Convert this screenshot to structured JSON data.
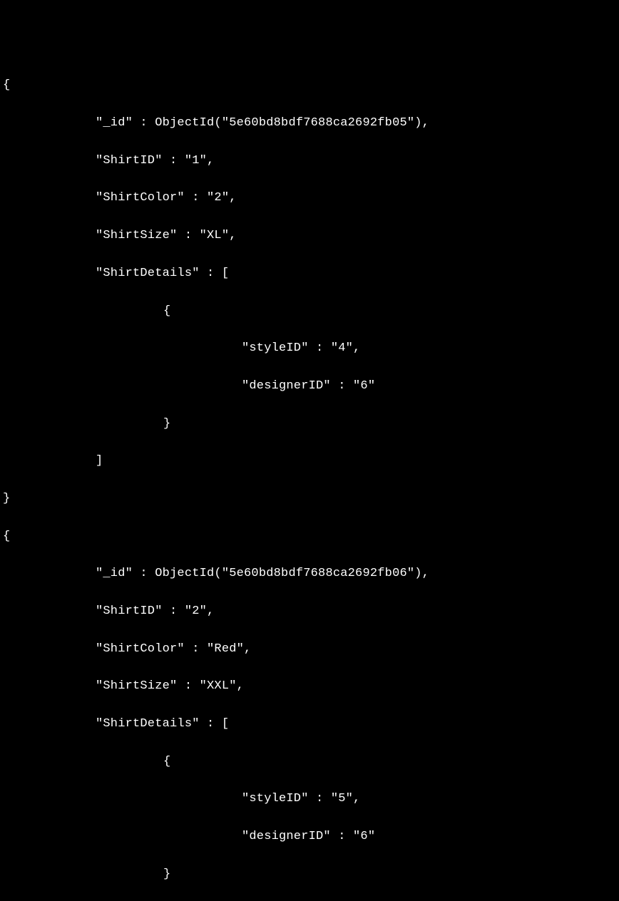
{
  "documents": [
    {
      "open_brace": "{",
      "id_line": "\"_id\" : ObjectId(\"5e60bd8bdf7688ca2692fb05\"),",
      "shirt_id_line": "\"ShirtID\" : \"1\",",
      "shirt_color_line": "\"ShirtColor\" : \"2\",",
      "shirt_size_line": "\"ShirtSize\" : \"XL\",",
      "shirt_details_open": "\"ShirtDetails\" : [",
      "inner_open_brace": "{",
      "style_id_line": "\"styleID\" : \"4\",",
      "designer_id_line": "\"designerID\" : \"6\"",
      "inner_close_brace": "}",
      "array_close": "]",
      "close_brace": "}"
    },
    {
      "open_brace": "{",
      "id_line": "\"_id\" : ObjectId(\"5e60bd8bdf7688ca2692fb06\"),",
      "shirt_id_line": "\"ShirtID\" : \"2\",",
      "shirt_color_line": "\"ShirtColor\" : \"Red\",",
      "shirt_size_line": "\"ShirtSize\" : \"XXL\",",
      "shirt_details_open": "\"ShirtDetails\" : [",
      "inner_open_brace": "{",
      "style_id_line": "\"styleID\" : \"5\",",
      "designer_id_line": "\"designerID\" : \"6\"",
      "inner_close_brace": "}"
    }
  ]
}
